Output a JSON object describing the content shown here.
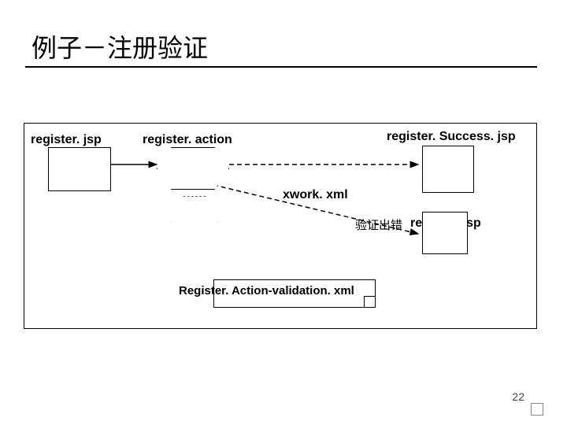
{
  "title": "例子－注册验证",
  "page_number": "22",
  "diagram": {
    "nodes": {
      "register_jsp_left": {
        "label": "register. jsp"
      },
      "register_action": {
        "label": "register. action"
      },
      "register_success": {
        "label": "register. Success. jsp"
      },
      "register_jsp_right": {
        "label": "register. jsp"
      },
      "validation_doc": {
        "label": "Register. Action-validation. xml"
      }
    },
    "edges": {
      "action_to_success": {
        "label": "xwork. xml"
      },
      "action_to_register_again": {
        "label": "验证出错"
      }
    }
  }
}
